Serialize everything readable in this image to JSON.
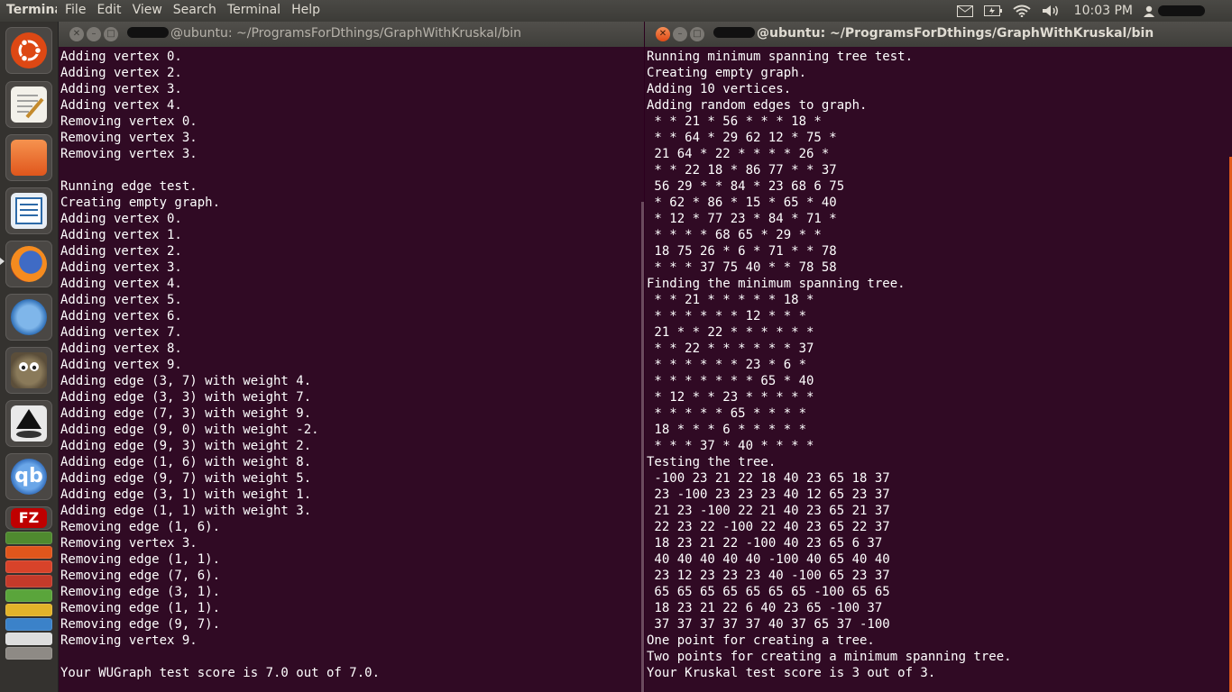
{
  "top_panel": {
    "app_name": "Terminal",
    "menu": [
      "File",
      "Edit",
      "View",
      "Search",
      "Terminal",
      "Help"
    ],
    "clock": "10:03 PM"
  },
  "launcher": {
    "items": [
      "dash-home",
      "text-editor",
      "files",
      "libreoffice-writer",
      "firefox",
      "bluefish",
      "gimp",
      "inkscape",
      "qbittorrent",
      "filezilla",
      "stacked-apps"
    ]
  },
  "terminal_left": {
    "title": "@ubuntu: ~/ProgramsForDthings/GraphWithKruskal/bin",
    "output": [
      "Adding vertex 0.",
      "Adding vertex 2.",
      "Adding vertex 3.",
      "Adding vertex 4.",
      "Removing vertex 0.",
      "Removing vertex 3.",
      "Removing vertex 3.",
      "",
      "Running edge test.",
      "Creating empty graph.",
      "Adding vertex 0.",
      "Adding vertex 1.",
      "Adding vertex 2.",
      "Adding vertex 3.",
      "Adding vertex 4.",
      "Adding vertex 5.",
      "Adding vertex 6.",
      "Adding vertex 7.",
      "Adding vertex 8.",
      "Adding vertex 9.",
      "Adding edge (3, 7) with weight 4.",
      "Adding edge (3, 3) with weight 7.",
      "Adding edge (7, 3) with weight 9.",
      "Adding edge (9, 0) with weight -2.",
      "Adding edge (9, 3) with weight 2.",
      "Adding edge (1, 6) with weight 8.",
      "Adding edge (9, 7) with weight 5.",
      "Adding edge (3, 1) with weight 1.",
      "Adding edge (1, 1) with weight 3.",
      "Removing edge (1, 6).",
      "Removing vertex 3.",
      "Removing edge (1, 1).",
      "Removing edge (7, 6).",
      "Removing edge (3, 1).",
      "Removing edge (1, 1).",
      "Removing edge (9, 7).",
      "Removing vertex 9.",
      "",
      "Your WUGraph test score is 7.0 out of 7.0."
    ]
  },
  "terminal_right": {
    "title": "@ubuntu: ~/ProgramsForDthings/GraphWithKruskal/bin",
    "output": [
      "Running minimum spanning tree test.",
      "Creating empty graph.",
      "Adding 10 vertices.",
      "Adding random edges to graph.",
      " * * 21 * 56 * * * 18 *",
      " * * 64 * 29 62 12 * 75 *",
      " 21 64 * 22 * * * * 26 *",
      " * * 22 18 * 86 77 * * 37",
      " 56 29 * * 84 * 23 68 6 75",
      " * 62 * 86 * 15 * 65 * 40",
      " * 12 * 77 23 * 84 * 71 *",
      " * * * * 68 65 * 29 * *",
      " 18 75 26 * 6 * 71 * * 78",
      " * * * 37 75 40 * * 78 58",
      "Finding the minimum spanning tree.",
      " * * 21 * * * * * 18 *",
      " * * * * * * 12 * * *",
      " 21 * * 22 * * * * * *",
      " * * 22 * * * * * * 37",
      " * * * * * * 23 * 6 *",
      " * * * * * * * 65 * 40",
      " * 12 * * 23 * * * * *",
      " * * * * * 65 * * * *",
      " 18 * * * 6 * * * * *",
      " * * * 37 * 40 * * * *",
      "Testing the tree.",
      " -100 23 21 22 18 40 23 65 18 37",
      " 23 -100 23 23 23 40 12 65 23 37",
      " 21 23 -100 22 21 40 23 65 21 37",
      " 22 23 22 -100 22 40 23 65 22 37",
      " 18 23 21 22 -100 40 23 65 6 37",
      " 40 40 40 40 40 -100 40 65 40 40",
      " 23 12 23 23 23 40 -100 65 23 37",
      " 65 65 65 65 65 65 65 -100 65 65",
      " 18 23 21 22 6 40 23 65 -100 37",
      " 37 37 37 37 37 40 37 65 37 -100",
      "One point for creating a tree.",
      "Two points for creating a minimum spanning tree.",
      "Your Kruskal test score is 3 out of 3."
    ]
  }
}
